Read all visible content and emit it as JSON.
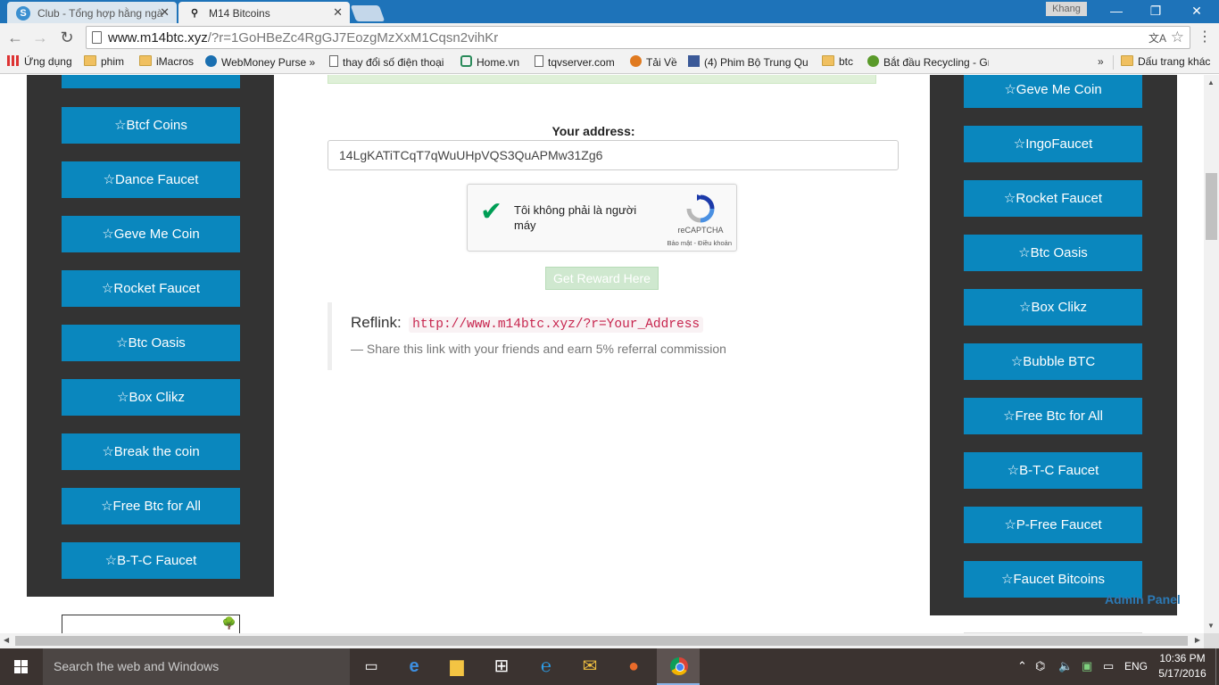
{
  "browser": {
    "tabs": [
      {
        "title": "Club - Tổng hợp hằng ngà",
        "icon": "coin-s-icon"
      },
      {
        "title": "M14 Bitcoins",
        "icon": "faucet-icon"
      }
    ],
    "profile_name": "Khang",
    "url_host": "www.m14btc.xyz",
    "url_path": "/?r=1GoHBeZc4RgGJ7EozgMzXxM1Cqsn2vihKr",
    "bookmarks": [
      {
        "label": "Ứng dụng",
        "icon": "apps-grid-icon"
      },
      {
        "label": "phim",
        "icon": "folder-icon"
      },
      {
        "label": "iMacros",
        "icon": "folder-icon"
      },
      {
        "label": "WebMoney Purse »",
        "icon": "globe-icon"
      },
      {
        "label": "thay đổi số điện thoại",
        "icon": "page-icon"
      },
      {
        "label": "Home.vn",
        "icon": "home-icon"
      },
      {
        "label": "tqvserver.com",
        "icon": "page-icon"
      },
      {
        "label": "Tải Về",
        "icon": "download-icon"
      },
      {
        "label": "(4) Phim Bộ Trung Qu",
        "icon": "facebook-icon"
      },
      {
        "label": "btc",
        "icon": "folder-icon"
      },
      {
        "label": "Bắt đầu Recycling - Gr",
        "icon": "recycle-icon"
      }
    ],
    "bookmarks_overflow": "»",
    "other_bookmarks": "Dấu trang khác"
  },
  "page": {
    "left_faucets": [
      "Btcf Coins",
      "Dance Faucet",
      "Geve Me Coin",
      "Rocket Faucet",
      "Btc Oasis",
      "Box Clikz",
      "Break the coin",
      "Free Btc for All",
      "B-T-C Faucet"
    ],
    "right_faucets": [
      "Geve Me Coin",
      "IngoFaucet",
      "Rocket Faucet",
      "Btc Oasis",
      "Box Clikz",
      "Bubble BTC",
      "Free Btc for All",
      "B-T-C Faucet",
      "P-Free Faucet",
      "Faucet Bitcoins"
    ],
    "faucet_prefix": "☆",
    "admin_link": "Admin Panel",
    "address_label": "Your address:",
    "address_value": "14LgKATiTCqT7qWuUHpVQS3QuAPMw31Zg6",
    "recaptcha": {
      "label": "Tôi không phải là người máy",
      "brand": "reCAPTCHA",
      "links": "Bảo mật - Điều khoản",
      "checked": true
    },
    "reward_button": "Get Reward Here",
    "reflink_title": "Reflink:",
    "reflink_url": "http://www.m14btc.xyz/?r=Your_Address",
    "reflink_note": "— Share this link with your friends and earn 5% referral commission"
  },
  "taskbar": {
    "search_placeholder": "Search the web and Windows",
    "language": "ENG",
    "time": "10:36 PM",
    "date": "5/17/2016",
    "apps": [
      "task-view-icon",
      "edge-icon",
      "file-explorer-icon",
      "store-icon",
      "ie-icon",
      "mail-icon",
      "firefox-icon",
      "chrome-icon"
    ]
  },
  "colors": {
    "faucet_button": "#0a87be",
    "panel": "#333333",
    "reflink_code": "#c7254e",
    "taskbar": "#3b3330"
  }
}
